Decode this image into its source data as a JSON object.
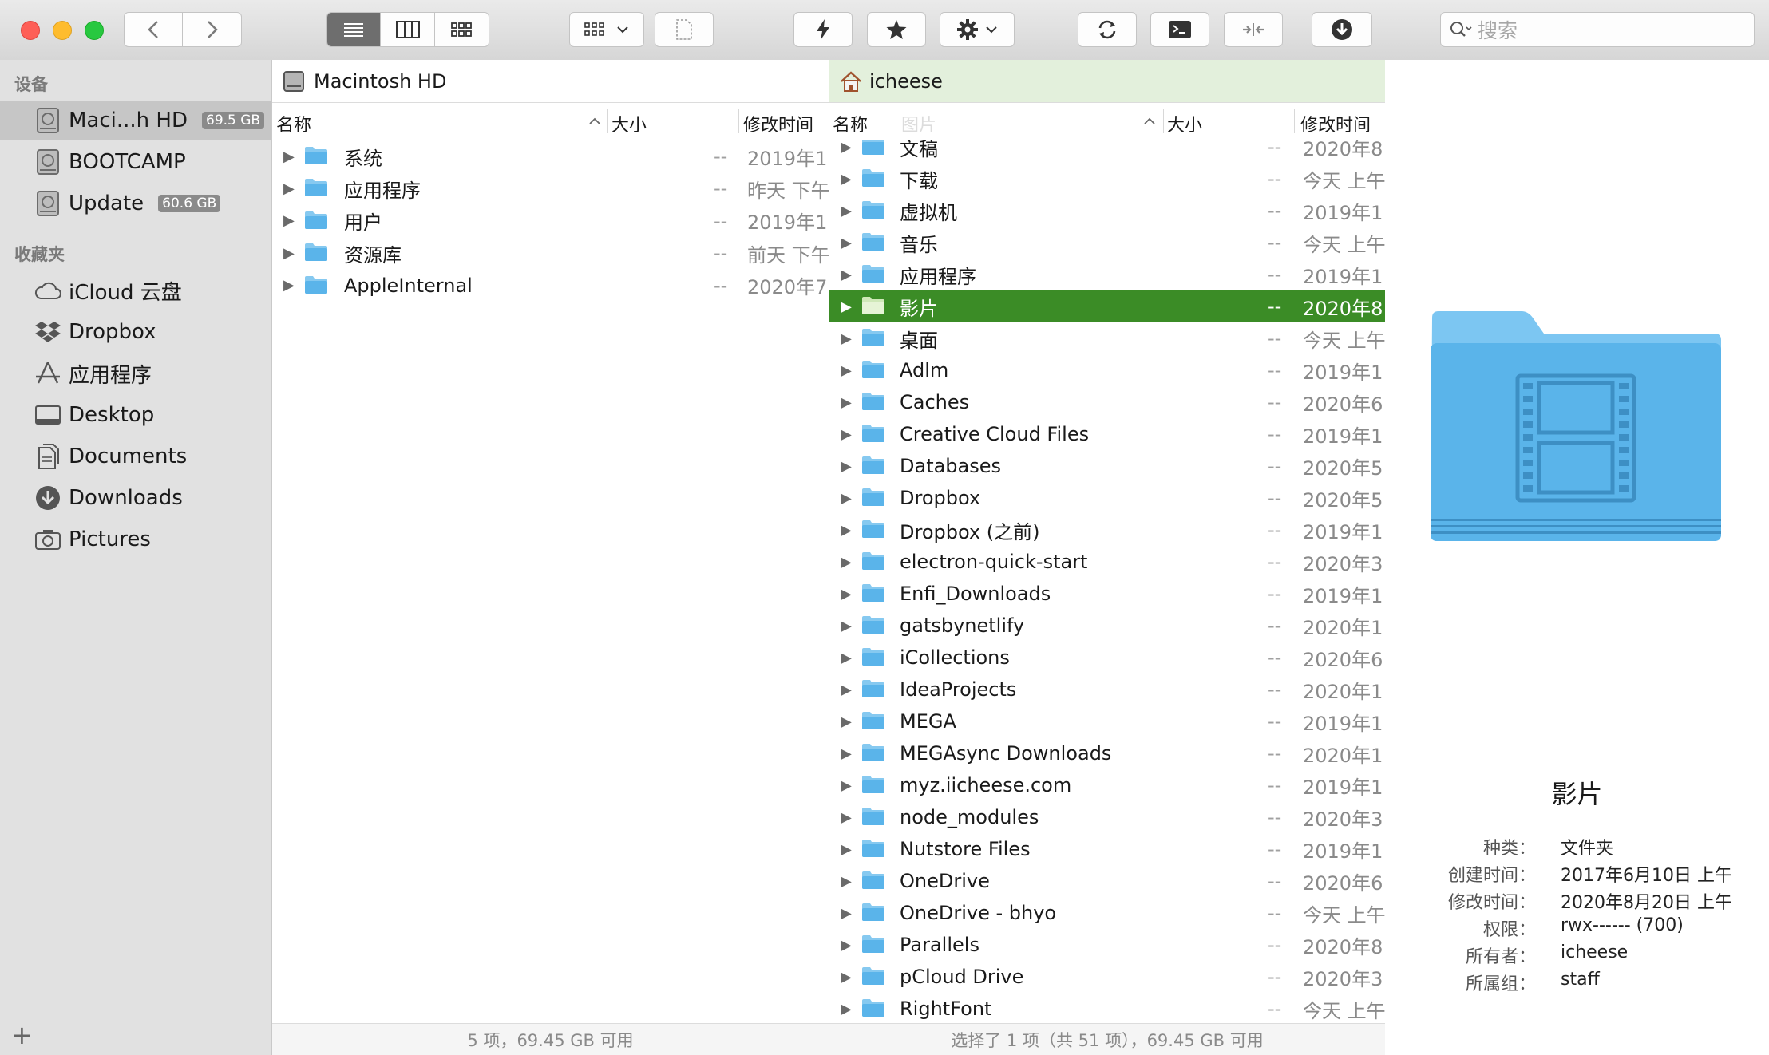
{
  "toolbar": {
    "search_placeholder": "搜索",
    "icons": [
      "back-chevron",
      "forward-chevron",
      "list-view",
      "column-view",
      "icon-view",
      "group-options",
      "new-file",
      "lightning",
      "star",
      "gear",
      "sync",
      "terminal",
      "compress",
      "download"
    ]
  },
  "sidebar": {
    "devices_header": "设备",
    "devices": [
      {
        "label": "Maci...h HD",
        "badge": "69.5 GB",
        "selected": true
      },
      {
        "label": "BOOTCAMP",
        "badge": ""
      },
      {
        "label": "Update",
        "badge": "60.6 GB"
      }
    ],
    "favorites_header": "收藏夹",
    "favorites": [
      {
        "label": "iCloud 云盘",
        "icon": "cloud-icon"
      },
      {
        "label": "Dropbox",
        "icon": "dropbox-icon"
      },
      {
        "label": "应用程序",
        "icon": "applications-icon"
      },
      {
        "label": "Desktop",
        "icon": "desktop-icon"
      },
      {
        "label": "Documents",
        "icon": "documents-icon"
      },
      {
        "label": "Downloads",
        "icon": "downloads-icon"
      },
      {
        "label": "Pictures",
        "icon": "camera-icon"
      }
    ],
    "add_label": "+"
  },
  "left_pane": {
    "title": "Macintosh HD",
    "col_name": "名称",
    "col_size": "大小",
    "col_date": "修改时间",
    "rows": [
      {
        "name": "系统",
        "size": "--",
        "date": "2019年1"
      },
      {
        "name": "应用程序",
        "size": "--",
        "date": "昨天 下午"
      },
      {
        "name": "用户",
        "size": "--",
        "date": "2019年1"
      },
      {
        "name": "资源库",
        "size": "--",
        "date": "前天 下午"
      },
      {
        "name": "AppleInternal",
        "size": "--",
        "date": "2020年7"
      }
    ],
    "status": "5 项，69.45 GB 可用"
  },
  "right_pane": {
    "title": "icheese",
    "col_name": "名称",
    "col_ghost": "图片",
    "col_size": "大小",
    "col_date": "修改时间",
    "rows": [
      {
        "name": "文稿",
        "size": "--",
        "date": "2020年8"
      },
      {
        "name": "下载",
        "size": "--",
        "date": "今天 上午"
      },
      {
        "name": "虚拟机",
        "size": "--",
        "date": "2019年1"
      },
      {
        "name": "音乐",
        "size": "--",
        "date": "今天 上午"
      },
      {
        "name": "应用程序",
        "size": "--",
        "date": "2019年1"
      },
      {
        "name": "影片",
        "size": "--",
        "date": "2020年8",
        "selected": true
      },
      {
        "name": "桌面",
        "size": "--",
        "date": "今天 上午"
      },
      {
        "name": "Adlm",
        "size": "--",
        "date": "2019年1"
      },
      {
        "name": "Caches",
        "size": "--",
        "date": "2020年6"
      },
      {
        "name": "Creative Cloud Files",
        "size": "--",
        "date": "2019年1"
      },
      {
        "name": "Databases",
        "size": "--",
        "date": "2020年5"
      },
      {
        "name": "Dropbox",
        "size": "--",
        "date": "2020年5"
      },
      {
        "name": "Dropbox (之前)",
        "size": "--",
        "date": "2019年1"
      },
      {
        "name": "electron-quick-start",
        "size": "--",
        "date": "2020年3"
      },
      {
        "name": "Enfi_Downloads",
        "size": "--",
        "date": "2019年1"
      },
      {
        "name": "gatsbynetlify",
        "size": "--",
        "date": "2020年1"
      },
      {
        "name": "iCollections",
        "size": "--",
        "date": "2020年6"
      },
      {
        "name": "IdeaProjects",
        "size": "--",
        "date": "2020年1"
      },
      {
        "name": "MEGA",
        "size": "--",
        "date": "2019年1"
      },
      {
        "name": "MEGAsync Downloads",
        "size": "--",
        "date": "2020年1"
      },
      {
        "name": "myz.iicheese.com",
        "size": "--",
        "date": "2019年1"
      },
      {
        "name": "node_modules",
        "size": "--",
        "date": "2020年3"
      },
      {
        "name": "Nutstore Files",
        "size": "--",
        "date": "2019年1"
      },
      {
        "name": "OneDrive",
        "size": "--",
        "date": "2020年6"
      },
      {
        "name": "OneDrive - bhyo",
        "size": "--",
        "date": "今天 上午"
      },
      {
        "name": "Parallels",
        "size": "--",
        "date": "2020年8"
      },
      {
        "name": "pCloud Drive",
        "size": "--",
        "date": "2020年3"
      },
      {
        "name": "RightFont",
        "size": "--",
        "date": "今天 上午"
      }
    ],
    "status": "选择了 1 项（共 51 项），69.45 GB 可用"
  },
  "preview": {
    "name": "影片",
    "info": [
      {
        "label": "种类：",
        "value": "文件夹"
      },
      {
        "label": "创建时间：",
        "value": "2017年6月10日 上午"
      },
      {
        "label": "修改时间：",
        "value": "2020年8月20日 上午"
      },
      {
        "label": "权限：",
        "value": "rwx------ (700)"
      },
      {
        "label": "所有者：",
        "value": "icheese"
      },
      {
        "label": "所属组：",
        "value": "staff"
      }
    ]
  },
  "colors": {
    "selection_green": "#3b8c26",
    "folder_blue": "#5ab4ea",
    "title_bar_green": "#e3f0dc"
  }
}
